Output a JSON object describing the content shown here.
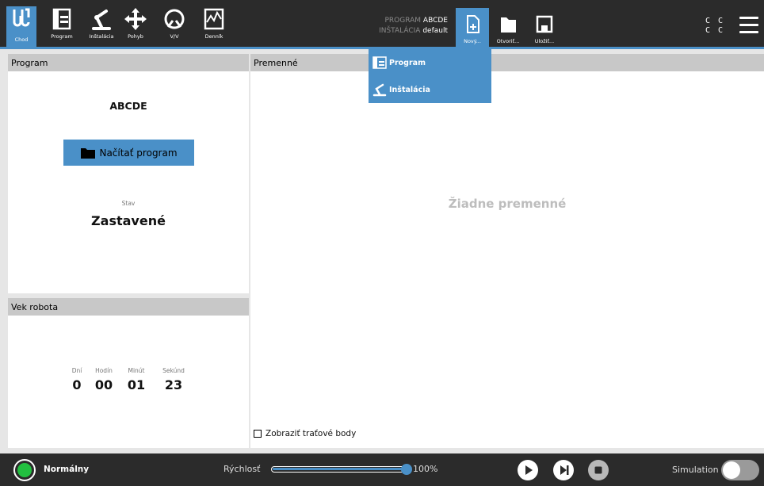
{
  "topbar": {
    "nav": [
      {
        "id": "run",
        "label": "Chod",
        "icon": "ur-logo-icon"
      },
      {
        "id": "program",
        "label": "Program",
        "icon": "program-icon"
      },
      {
        "id": "install",
        "label": "Inštalácia",
        "icon": "robot-arm-icon"
      },
      {
        "id": "move",
        "label": "Pohyb",
        "icon": "move-arrows-icon"
      },
      {
        "id": "io",
        "label": "V/V",
        "icon": "io-icon"
      },
      {
        "id": "log",
        "label": "Denník",
        "icon": "log-icon"
      }
    ],
    "program_key": "PROGRAM",
    "program_value": "ABCDE",
    "install_key": "INŠTALÁCIA",
    "install_value": "default",
    "new_label": "Nový...",
    "open_label": "Otvoriť...",
    "save_label": "Uložiť...",
    "cc_text": "C C\nC C"
  },
  "new_menu": {
    "program_label": "Program",
    "install_label": "Inštalácia"
  },
  "program_panel": {
    "title": "Program",
    "program_name": "ABCDE",
    "load_button": "Načítať program",
    "state_label": "Stav",
    "state_value": "Zastavené"
  },
  "vars_panel": {
    "title": "Premenné",
    "empty_text": "Žiadne premenné",
    "show_waypoints": "Zobraziť traťové body"
  },
  "age_panel": {
    "title": "Vek robota",
    "days_label": "Dní",
    "days_value": "0",
    "hours_label": "Hodín",
    "hours_value": "00",
    "minutes_label": "Minút",
    "minutes_value": "01",
    "seconds_label": "Sekúnd",
    "seconds_value": "23"
  },
  "bottombar": {
    "status": "Normálny",
    "status_color": "#22c040",
    "speed_label": "Rýchlosť",
    "speed_percent": 100,
    "speed_value": "100%",
    "simulation_label": "Simulation",
    "simulation_on": false
  },
  "colors": {
    "accent": "#4a90c8",
    "bar": "#2b2b2b",
    "header": "#c8c8c8"
  }
}
